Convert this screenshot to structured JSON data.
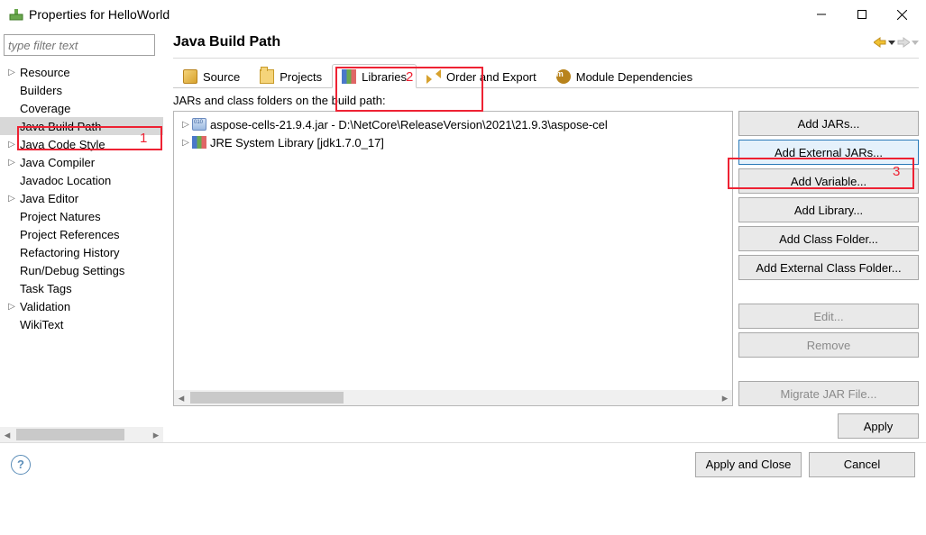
{
  "window": {
    "title": "Properties for HelloWorld"
  },
  "filter_placeholder": "type filter text",
  "nav": [
    {
      "label": "Resource",
      "expand": true
    },
    {
      "label": "Builders",
      "expand": false
    },
    {
      "label": "Coverage",
      "expand": false
    },
    {
      "label": "Java Build Path",
      "expand": false,
      "selected": true
    },
    {
      "label": "Java Code Style",
      "expand": true
    },
    {
      "label": "Java Compiler",
      "expand": true
    },
    {
      "label": "Javadoc Location",
      "expand": false
    },
    {
      "label": "Java Editor",
      "expand": true
    },
    {
      "label": "Project Natures",
      "expand": false
    },
    {
      "label": "Project References",
      "expand": false
    },
    {
      "label": "Refactoring History",
      "expand": false
    },
    {
      "label": "Run/Debug Settings",
      "expand": false
    },
    {
      "label": "Task Tags",
      "expand": false
    },
    {
      "label": "Validation",
      "expand": true
    },
    {
      "label": "WikiText",
      "expand": false
    }
  ],
  "page_title": "Java Build Path",
  "tabs": {
    "source": "Source",
    "projects": "Projects",
    "libraries": "Libraries",
    "order": "Order and Export",
    "modules": "Module Dependencies"
  },
  "libs_caption": "JARs and class folders on the build path:",
  "lib_entries": [
    {
      "label": "aspose-cells-21.9.4.jar - D:\\NetCore\\ReleaseVersion\\2021\\21.9.3\\aspose-cel",
      "icon": "jar"
    },
    {
      "label": "JRE System Library [jdk1.7.0_17]",
      "icon": "jre"
    }
  ],
  "buttons": {
    "add_jars": "Add JARs...",
    "add_ext_jars": "Add External JARs...",
    "add_var": "Add Variable...",
    "add_lib": "Add Library...",
    "add_cf": "Add Class Folder...",
    "add_ext_cf": "Add External Class Folder...",
    "edit": "Edit...",
    "remove": "Remove",
    "migrate": "Migrate JAR File...",
    "apply": "Apply",
    "apply_close": "Apply and Close",
    "cancel": "Cancel"
  },
  "annotations": {
    "n1": "1",
    "n2": "2",
    "n3": "3"
  }
}
